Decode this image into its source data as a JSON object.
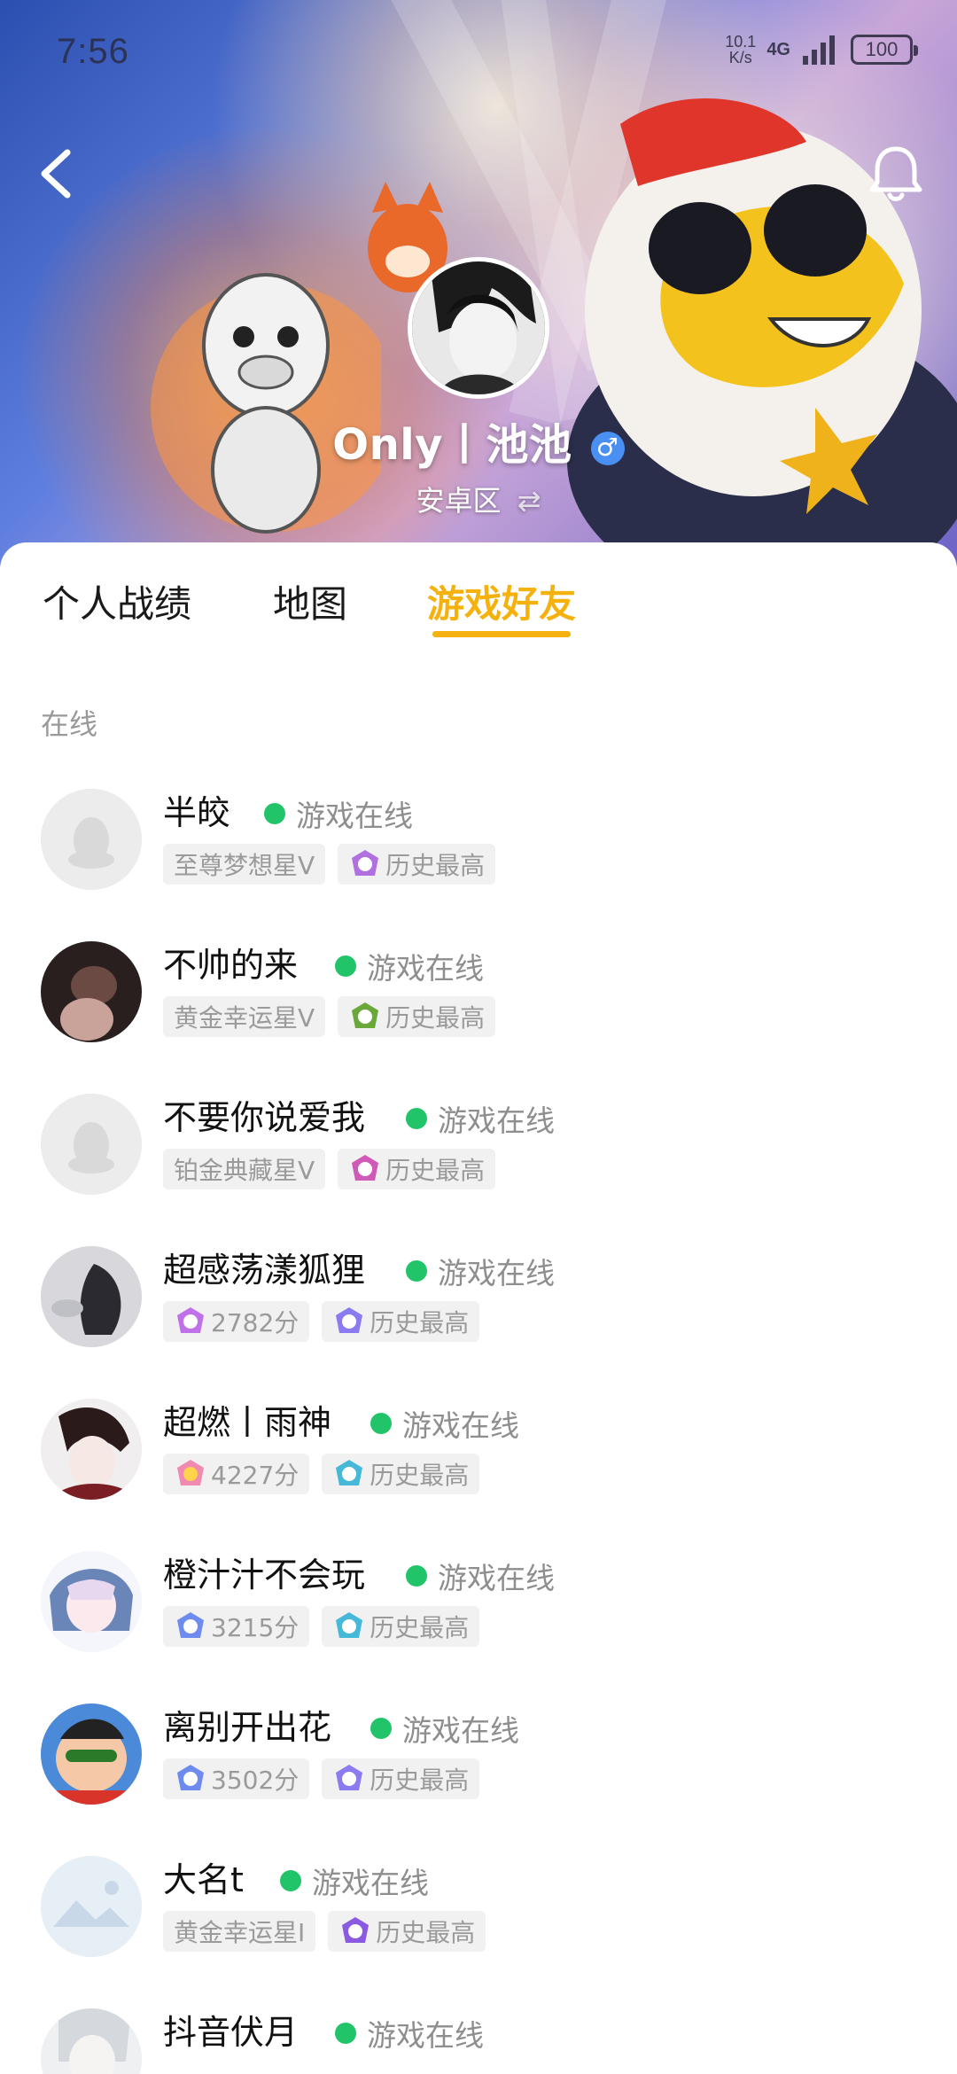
{
  "status_bar": {
    "time": "7:56",
    "net_speed_top": "10.1",
    "net_speed_bottom": "K/s",
    "net_type": "4G",
    "battery": "100"
  },
  "profile": {
    "name": "Only丨池池",
    "gender_symbol": "♂",
    "region": "安卓区",
    "swap_symbol": "⇄"
  },
  "tabs": [
    {
      "label": "个人战绩"
    },
    {
      "label": "地图"
    },
    {
      "label": "游戏好友"
    }
  ],
  "section_label": "在线",
  "friends": [
    {
      "name": "半皎",
      "status": "游戏在线",
      "tag1": "至尊梦想星V",
      "tag2": "历史最高",
      "tag2_icon_color": "#b070e0"
    },
    {
      "name": "不帅的来",
      "status": "游戏在线",
      "tag1": "黄金幸运星V",
      "tag2": "历史最高",
      "tag2_icon_color": "#6aa83a"
    },
    {
      "name": "不要你说爱我",
      "status": "游戏在线",
      "tag1": "铂金典藏星V",
      "tag2": "历史最高",
      "tag2_icon_color": "#d05ab8"
    },
    {
      "name": "超感荡漾狐狸",
      "status": "游戏在线",
      "tag1": "2782分",
      "tag2": "历史最高",
      "tag1_icon_color": "#c070e8",
      "tag2_icon_color": "#8a7cf0"
    },
    {
      "name": "超燃丨雨神",
      "status": "游戏在线",
      "tag1": "4227分",
      "tag2": "历史最高",
      "tag1_icon_color": "#f08ab0",
      "tag2_icon_color": "#46b8d8"
    },
    {
      "name": "橙汁汁不会玩",
      "status": "游戏在线",
      "tag1": "3215分",
      "tag2": "历史最高",
      "tag1_icon_color": "#6e8cf0",
      "tag2_icon_color": "#46b8d8"
    },
    {
      "name": "离别开出花",
      "status": "游戏在线",
      "tag1": "3502分",
      "tag2": "历史最高",
      "tag1_icon_color": "#6e8cf0",
      "tag2_icon_color": "#8a7cf0"
    },
    {
      "name": "大名t",
      "status": "游戏在线",
      "tag1": "黄金幸运星I",
      "tag2": "历史最高",
      "tag2_icon_color": "#8a5ae0"
    },
    {
      "name": "抖音伏月",
      "status": "游戏在线"
    }
  ],
  "colors": {
    "accent": "#f5b20e",
    "online_dot": "#22c46a",
    "tag_bg": "#f1f1f1"
  }
}
